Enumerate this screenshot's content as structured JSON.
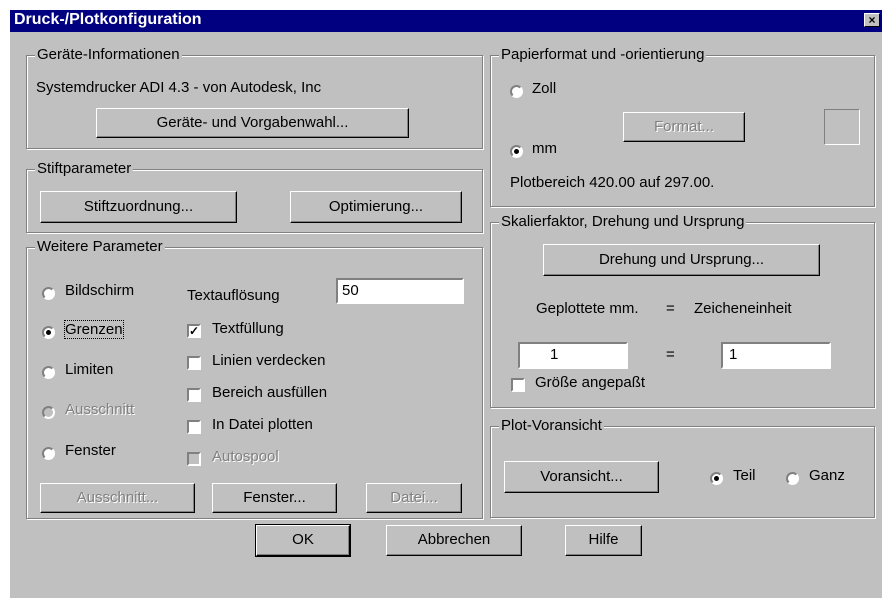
{
  "dialog": {
    "title": "Druck-/Plotkonfiguration",
    "close_glyph": "×"
  },
  "device_info": {
    "legend": "Geräte-Informationen",
    "printer": "Systemdrucker ADI 4.3 - von Autodesk, Inc",
    "select_button": "Geräte- und Vorgabenwahl..."
  },
  "pen_params": {
    "legend": "Stiftparameter",
    "assignment_button": "Stiftzuordnung...",
    "optimize_button": "Optimierung..."
  },
  "more_params": {
    "legend": "Weitere Parameter",
    "area_options": [
      {
        "label": "Bildschirm",
        "checked": false,
        "disabled": false
      },
      {
        "label": "Grenzen",
        "checked": true,
        "disabled": false
      },
      {
        "label": "Limiten",
        "checked": false,
        "disabled": false
      },
      {
        "label": "Ausschnitt",
        "checked": false,
        "disabled": true
      },
      {
        "label": "Fenster",
        "checked": false,
        "disabled": false
      }
    ],
    "text_resolution_label": "Textauflösung",
    "text_resolution_value": "50",
    "checkboxes": [
      {
        "label": "Textfüllung",
        "checked": true,
        "disabled": false
      },
      {
        "label": "Linien verdecken",
        "checked": false,
        "disabled": false
      },
      {
        "label": "Bereich ausfüllen",
        "checked": false,
        "disabled": false
      },
      {
        "label": "In Datei plotten",
        "checked": false,
        "disabled": false
      },
      {
        "label": "Autospool",
        "checked": false,
        "disabled": true
      }
    ],
    "view_button": "Ausschnitt...",
    "window_button": "Fenster...",
    "file_button": "Datei..."
  },
  "paper": {
    "legend": "Papierformat und -orientierung",
    "unit_inch": "Zoll",
    "unit_mm": "mm",
    "selected_unit": "mm",
    "format_button": "Format...",
    "plot_area": "Plotbereich 420.00 auf 297.00."
  },
  "scale": {
    "legend": "Skalierfaktor, Drehung und Ursprung",
    "rotation_button": "Drehung und Ursprung...",
    "plotted_label": "Geplottete mm.",
    "equals": "=",
    "drawing_units_label": "Zeicheneinheit",
    "plotted_value": "1",
    "drawing_value": "1",
    "fit_label": "Größe angepaßt",
    "fit_checked": false
  },
  "preview": {
    "legend": "Plot-Voransicht",
    "preview_button": "Voransicht...",
    "partial_label": "Teil",
    "full_label": "Ganz",
    "selected": "Teil"
  },
  "footer": {
    "ok": "OK",
    "cancel": "Abbrechen",
    "help": "Hilfe"
  }
}
